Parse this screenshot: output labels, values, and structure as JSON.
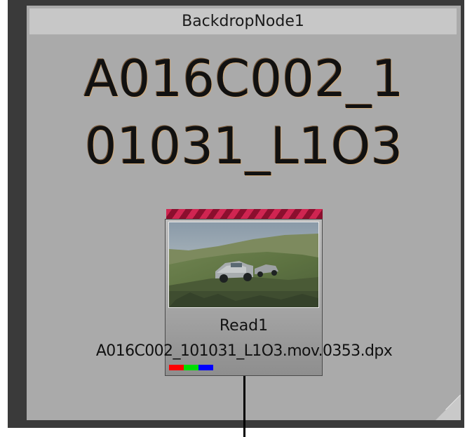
{
  "backdrop": {
    "title": "BackdropNode1",
    "label_line1": "A016C002_1",
    "label_line2": "01031_L1O3",
    "color": "#aaaaaa"
  },
  "read_node": {
    "name": "Read1",
    "file": "A016C002_101031_L1O3.mov.0353.dpx",
    "tile_color": "#d02551",
    "channels": [
      "#ff0000",
      "#00dd00",
      "#0000ff"
    ]
  }
}
